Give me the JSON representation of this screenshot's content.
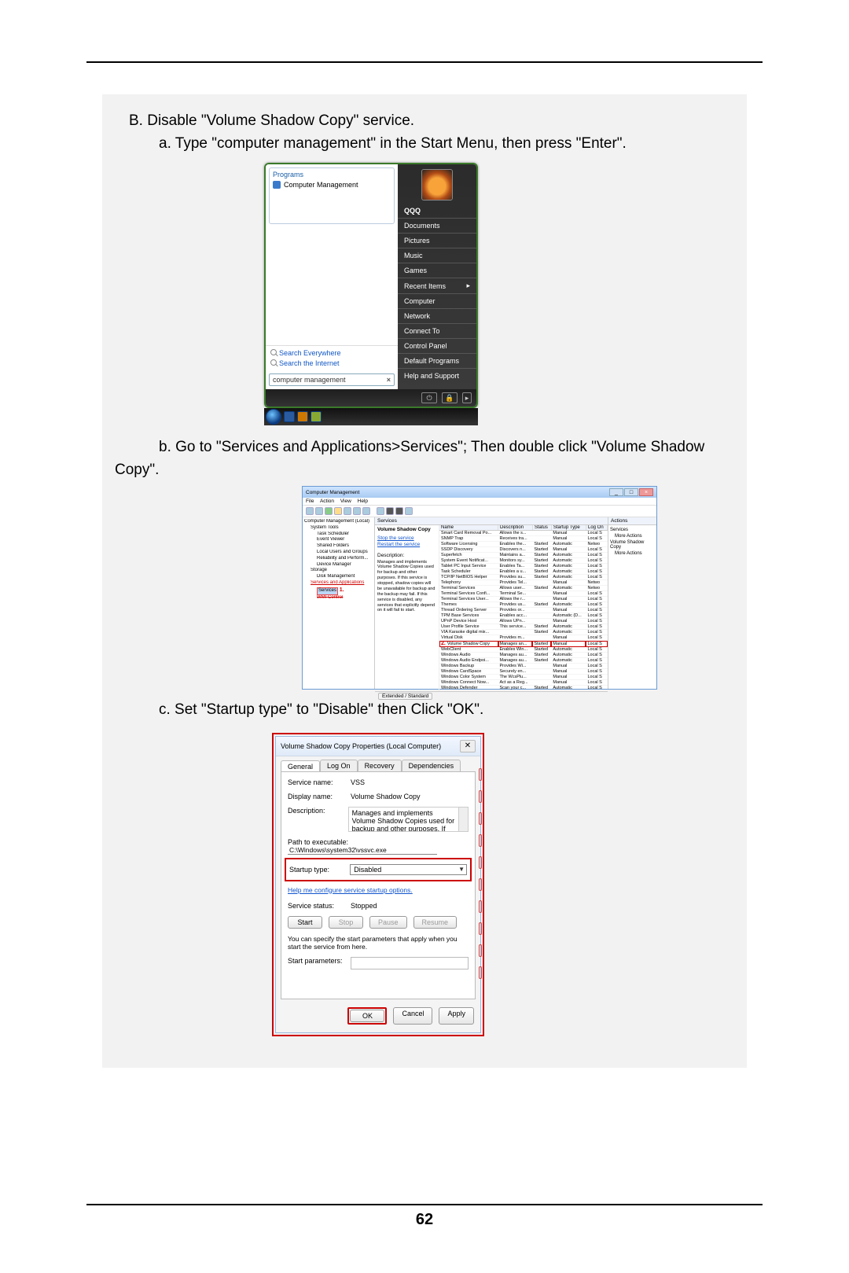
{
  "page_number": "62",
  "section_b": "B. Disable \"Volume Shadow Copy\" service.",
  "step_a": "a. Type \"computer management\" in the Start Menu, then press \"Enter\".",
  "step_b": "b. Go to \"Services and Applications>Services\"; Then double click \"Volume Shadow Copy\".",
  "step_c": "c. Set \"Startup type\" to \"Disable\" then Click \"OK\".",
  "startmenu": {
    "programs_header": "Programs",
    "program_item": "Computer Management",
    "search_everywhere": "Search Everywhere",
    "search_internet": "Search the Internet",
    "search_value": "computer management",
    "user": "QQQ",
    "right_items": [
      "Documents",
      "Pictures",
      "Music",
      "Games",
      "Recent Items",
      "Computer",
      "Network",
      "Connect To",
      "Control Panel",
      "Default Programs",
      "Help and Support"
    ]
  },
  "compmgmt": {
    "title": "Computer Management",
    "menu": [
      "File",
      "Action",
      "View",
      "Help"
    ],
    "tree": {
      "root": "Computer Management (Local)",
      "system_tools": "System Tools",
      "items1": [
        "Task Scheduler",
        "Event Viewer",
        "Shared Folders",
        "Local Users and Groups",
        "Reliability and Perform...",
        "Device Manager"
      ],
      "storage": "Storage",
      "items2": [
        "Disk Management"
      ],
      "saa": "Services and Applications",
      "services": "Services",
      "wmi": "WMI Control"
    },
    "red1": "1.",
    "red2": "2.",
    "services_header": "Services",
    "detail": {
      "title": "Volume Shadow Copy",
      "stop": "Stop the service",
      "restart": "Restart the service",
      "desc_label": "Description:",
      "desc": "Manages and implements Volume Shadow Copies used for backup and other purposes. If this service is stopped, shadow copies will be unavailable for backup and the backup may fail. If this service is disabled, any services that explicitly depend on it will fail to start."
    },
    "columns": [
      "Name",
      "Description",
      "Status",
      "Startup Type",
      "Log On"
    ],
    "rows": [
      {
        "n": "Smart Card Removal Po...",
        "d": "Allows the s...",
        "s": "",
        "t": "Manual",
        "l": "Local S"
      },
      {
        "n": "SNMP Trap",
        "d": "Receives tra...",
        "s": "",
        "t": "Manual",
        "l": "Local S"
      },
      {
        "n": "Software Licensing",
        "d": "Enables the...",
        "s": "Started",
        "t": "Automatic",
        "l": "Netwo"
      },
      {
        "n": "SSDP Discovery",
        "d": "Discovers n...",
        "s": "Started",
        "t": "Manual",
        "l": "Local S"
      },
      {
        "n": "Superfetch",
        "d": "Maintains a...",
        "s": "Started",
        "t": "Automatic",
        "l": "Local S"
      },
      {
        "n": "System Event Notificat...",
        "d": "Monitors sy...",
        "s": "Started",
        "t": "Automatic",
        "l": "Local S"
      },
      {
        "n": "Tablet PC Input Service",
        "d": "Enables Ta...",
        "s": "Started",
        "t": "Automatic",
        "l": "Local S"
      },
      {
        "n": "Task Scheduler",
        "d": "Enables a u...",
        "s": "Started",
        "t": "Automatic",
        "l": "Local S"
      },
      {
        "n": "TCP/IP NetBIOS Helper",
        "d": "Provides su...",
        "s": "Started",
        "t": "Automatic",
        "l": "Local S"
      },
      {
        "n": "Telephony",
        "d": "Provides Tel...",
        "s": "",
        "t": "Manual",
        "l": "Netwo"
      },
      {
        "n": "Terminal Services",
        "d": "Allows user...",
        "s": "Started",
        "t": "Automatic",
        "l": "Netwo"
      },
      {
        "n": "Terminal Services Confi...",
        "d": "Terminal Se...",
        "s": "",
        "t": "Manual",
        "l": "Local S"
      },
      {
        "n": "Terminal Services User...",
        "d": "Allows the r...",
        "s": "",
        "t": "Manual",
        "l": "Local S"
      },
      {
        "n": "Themes",
        "d": "Provides us...",
        "s": "Started",
        "t": "Automatic",
        "l": "Local S"
      },
      {
        "n": "Thread Ordering Server",
        "d": "Provides or...",
        "s": "",
        "t": "Manual",
        "l": "Local S"
      },
      {
        "n": "TPM Base Services",
        "d": "Enables acc...",
        "s": "",
        "t": "Automatic (D...",
        "l": "Local S"
      },
      {
        "n": "UPnP Device Host",
        "d": "Allows UPn...",
        "s": "",
        "t": "Manual",
        "l": "Local S"
      },
      {
        "n": "User Profile Service",
        "d": "This service...",
        "s": "Started",
        "t": "Automatic",
        "l": "Local S"
      },
      {
        "n": "VIA Karaoke digital mix...",
        "d": "",
        "s": "Started",
        "t": "Automatic",
        "l": "Local S"
      },
      {
        "n": "Virtual Disk",
        "d": "Provides m...",
        "s": "",
        "t": "Manual",
        "l": "Local S"
      },
      {
        "n": "Volume Shadow Copy",
        "d": "Manages an...",
        "s": "Started",
        "t": "Manual",
        "l": "Local S",
        "sel": true
      },
      {
        "n": "WebClient",
        "d": "Enables Win...",
        "s": "Started",
        "t": "Automatic",
        "l": "Local S"
      },
      {
        "n": "Windows Audio",
        "d": "Manages au...",
        "s": "Started",
        "t": "Automatic",
        "l": "Local S"
      },
      {
        "n": "Windows Audio Endpoi...",
        "d": "Manages au...",
        "s": "Started",
        "t": "Automatic",
        "l": "Local S"
      },
      {
        "n": "Windows Backup",
        "d": "Provides Wi...",
        "s": "",
        "t": "Manual",
        "l": "Local S"
      },
      {
        "n": "Windows CardSpace",
        "d": "Securely en...",
        "s": "",
        "t": "Manual",
        "l": "Local S"
      },
      {
        "n": "Windows Color System",
        "d": "The WcsPlu...",
        "s": "",
        "t": "Manual",
        "l": "Local S"
      },
      {
        "n": "Windows Connect Now...",
        "d": "Act as a Reg...",
        "s": "",
        "t": "Manual",
        "l": "Local S"
      },
      {
        "n": "Windows Defender",
        "d": "Scan your c...",
        "s": "Started",
        "t": "Automatic",
        "l": "Local S"
      }
    ],
    "tabs": "Extended / Standard",
    "actions": {
      "header": "Actions",
      "a1": "Services",
      "a2": "More Actions",
      "a3": "Volume Shadow Copy",
      "a4": "More Actions"
    }
  },
  "dlg": {
    "title": "Volume Shadow Copy Properties (Local Computer)",
    "tabs": [
      "General",
      "Log On",
      "Recovery",
      "Dependencies"
    ],
    "service_name_lbl": "Service name:",
    "service_name": "VSS",
    "display_name_lbl": "Display name:",
    "display_name": "Volume Shadow Copy",
    "description_lbl": "Description:",
    "description": "Manages and implements Volume Shadow Copies used for backup and other purposes. If this service",
    "path_lbl": "Path to executable:",
    "path": "C:\\Windows\\system32\\vssvc.exe",
    "startup_lbl": "Startup type:",
    "startup_value": "Disabled",
    "help_link": "Help me configure service startup options.",
    "status_lbl": "Service status:",
    "status": "Stopped",
    "btn_start": "Start",
    "btn_stop": "Stop",
    "btn_pause": "Pause",
    "btn_resume": "Resume",
    "hint": "You can specify the start parameters that apply when you start the service from here.",
    "params_lbl": "Start parameters:",
    "btn_ok": "OK",
    "btn_cancel": "Cancel",
    "btn_apply": "Apply"
  }
}
